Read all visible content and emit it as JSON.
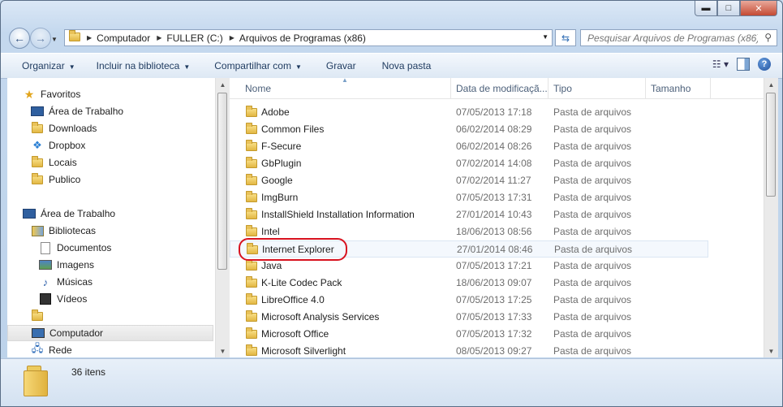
{
  "window": {
    "caption_buttons": {
      "minimize": "▬",
      "maximize": "□",
      "close": "✕"
    }
  },
  "nav": {
    "back_icon": "←",
    "forward_icon": "→",
    "breadcrumb": [
      "Computador",
      "FULLER (C:)",
      "Arquivos de Programas (x86)"
    ],
    "search_placeholder": "Pesquisar Arquivos de Programas (x86)"
  },
  "toolbar": {
    "organize": "Organizar",
    "include_library": "Incluir na biblioteca",
    "share": "Compartilhar com",
    "burn": "Gravar",
    "new_folder": "Nova pasta",
    "help": "?"
  },
  "sidebar": {
    "items": [
      {
        "label": "Favoritos",
        "icon": "star-icon"
      },
      {
        "label": "Área de Trabalho",
        "icon": "desktop-icon"
      },
      {
        "label": "Downloads",
        "icon": "downloads-icon"
      },
      {
        "label": "Dropbox",
        "icon": "dropbox-icon"
      },
      {
        "label": "Locais",
        "icon": "recent-places-icon"
      },
      {
        "label": "Publico",
        "icon": "folder-icon"
      },
      {
        "label": "Área de Trabalho",
        "icon": "desktop-icon"
      },
      {
        "label": "Bibliotecas",
        "icon": "libraries-icon"
      },
      {
        "label": "Documentos",
        "icon": "documents-icon"
      },
      {
        "label": "Imagens",
        "icon": "pictures-icon"
      },
      {
        "label": "Músicas",
        "icon": "music-icon"
      },
      {
        "label": "Vídeos",
        "icon": "videos-icon"
      },
      {
        "label": "",
        "icon": "user-folder-icon"
      },
      {
        "label": "Computador",
        "icon": "computer-icon"
      },
      {
        "label": "Rede",
        "icon": "network-icon"
      }
    ]
  },
  "columns": {
    "name": "Nome",
    "date": "Data de modificaçã...",
    "type": "Tipo",
    "size": "Tamanho"
  },
  "files": [
    {
      "name": "Adobe",
      "date": "07/05/2013 17:18",
      "type": "Pasta de arquivos"
    },
    {
      "name": "Common Files",
      "date": "06/02/2014 08:29",
      "type": "Pasta de arquivos"
    },
    {
      "name": "F-Secure",
      "date": "06/02/2014 08:26",
      "type": "Pasta de arquivos"
    },
    {
      "name": "GbPlugin",
      "date": "07/02/2014 14:08",
      "type": "Pasta de arquivos"
    },
    {
      "name": "Google",
      "date": "07/02/2014 11:27",
      "type": "Pasta de arquivos"
    },
    {
      "name": "ImgBurn",
      "date": "07/05/2013 17:31",
      "type": "Pasta de arquivos"
    },
    {
      "name": "InstallShield Installation Information",
      "date": "27/01/2014 10:43",
      "type": "Pasta de arquivos"
    },
    {
      "name": "Intel",
      "date": "18/06/2013 08:56",
      "type": "Pasta de arquivos"
    },
    {
      "name": "Internet Explorer",
      "date": "27/01/2014 08:46",
      "type": "Pasta de arquivos"
    },
    {
      "name": "Java",
      "date": "07/05/2013 17:21",
      "type": "Pasta de arquivos"
    },
    {
      "name": "K-Lite Codec Pack",
      "date": "18/06/2013 09:07",
      "type": "Pasta de arquivos"
    },
    {
      "name": "LibreOffice 4.0",
      "date": "07/05/2013 17:25",
      "type": "Pasta de arquivos"
    },
    {
      "name": "Microsoft Analysis Services",
      "date": "07/05/2013 17:33",
      "type": "Pasta de arquivos"
    },
    {
      "name": "Microsoft Office",
      "date": "07/05/2013 17:32",
      "type": "Pasta de arquivos"
    },
    {
      "name": "Microsoft Silverlight",
      "date": "08/05/2013 09:27",
      "type": "Pasta de arquivos"
    }
  ],
  "status": {
    "count": "36 itens"
  }
}
